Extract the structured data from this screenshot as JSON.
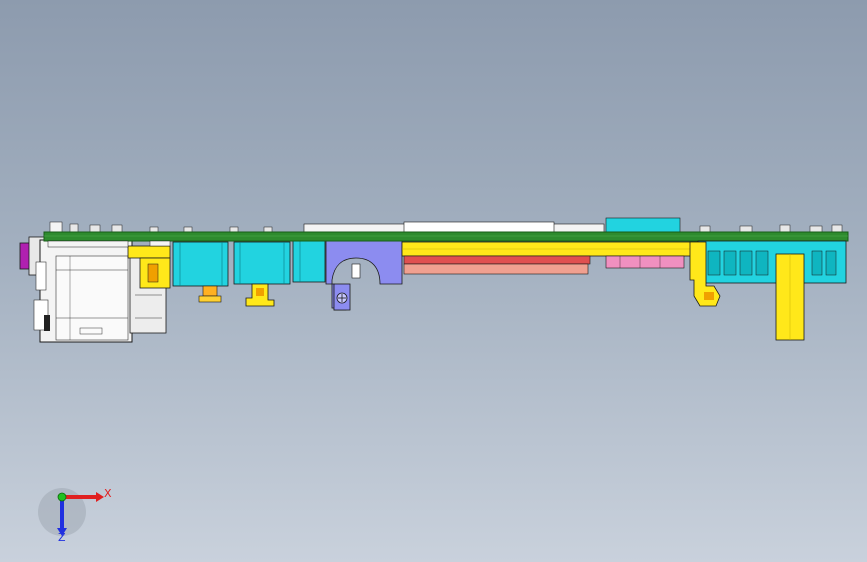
{
  "viewport": {
    "background_top": "#8d9bae",
    "background_bottom": "#c9d1dc"
  },
  "model": {
    "colors": {
      "pcb": "#2e8b2e",
      "pcb_edge": "#175c17",
      "connector_magenta": "#b020b0",
      "housing_white": "#f2f2f2",
      "cyan_block": "#22d3e0",
      "yellow_part": "#ffe81a",
      "blue_bracket": "#8c8cf0",
      "salmon_plate": "#f0a090",
      "pink_part": "#f090c0",
      "orange_part": "#ff9a2a",
      "outline": "#1a1a1a"
    }
  },
  "triad": {
    "x_label": "X",
    "z_label": "Z",
    "x_color": "#e02020",
    "y_color": "#20c020",
    "z_color": "#2030e0"
  }
}
